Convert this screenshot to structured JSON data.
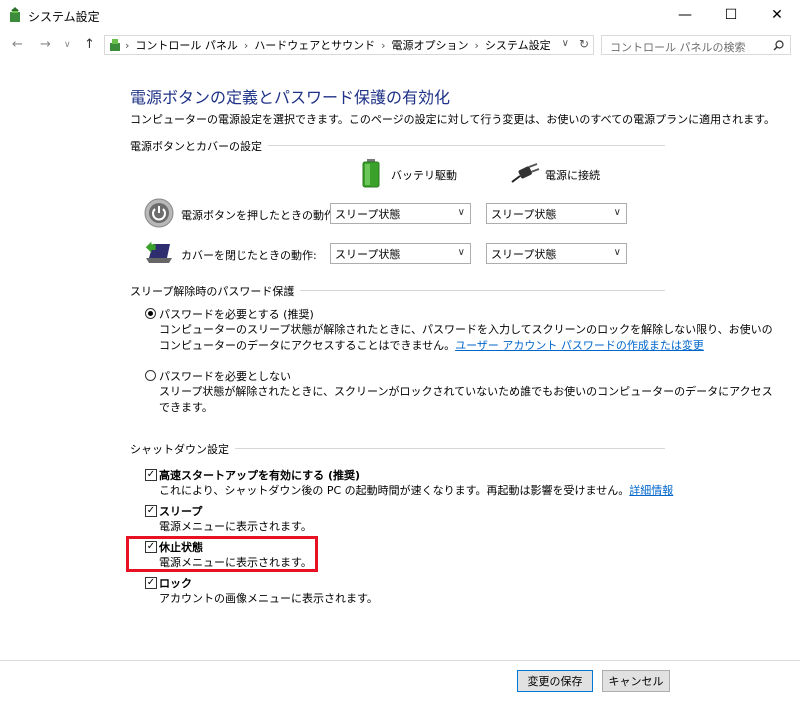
{
  "window": {
    "title": "システム設定",
    "minimize": "—",
    "maximize": "☐",
    "close": "✕"
  },
  "address": {
    "crumbs": [
      "コントロール パネル",
      "ハードウェアとサウンド",
      "電源オプション",
      "システム設定"
    ],
    "search_placeholder": "コントロール パネルの検索"
  },
  "page": {
    "title": "電源ボタンの定義とパスワード保護の有効化",
    "description": "コンピューターの電源設定を選択できます。このページの設定に対して行う変更は、お使いのすべての電源プランに適用されます。"
  },
  "power_buttons": {
    "group_title": "電源ボタンとカバーの設定",
    "col_battery": "バッテリ駆動",
    "col_plugged": "電源に接続",
    "rows": [
      {
        "label": "電源ボタンを押したときの動作:",
        "battery": "スリープ状態",
        "plugged": "スリープ状態"
      },
      {
        "label": "カバーを閉じたときの動作:",
        "battery": "スリープ状態",
        "plugged": "スリープ状態"
      }
    ]
  },
  "password": {
    "group_title": "スリープ解除時のパスワード保護",
    "options": [
      {
        "title": "パスワードを必要とする (推奨)",
        "selected": true,
        "line1": "コンピューターのスリープ状態が解除されたときに、パスワードを入力してスクリーンのロックを解除しない限り、お使いの",
        "line2": "コンピューターのデータにアクセスすることはできません。",
        "link": "ユーザー アカウント パスワードの作成または変更"
      },
      {
        "title": "パスワードを必要としない",
        "selected": false,
        "line1": "スリープ状態が解除されたときに、スクリーンがロックされていないため誰でもお使いのコンピューターのデータにアクセス",
        "line2": "できます。"
      }
    ]
  },
  "shutdown": {
    "group_title": "シャットダウン設定",
    "options": [
      {
        "title": "高速スタートアップを有効にする (推奨)",
        "checked": true,
        "desc": "これにより、シャットダウン後の PC の起動時間が速くなります。再起動は影響を受けません。",
        "link": "詳細情報"
      },
      {
        "title": "スリープ",
        "checked": true,
        "desc": "電源メニューに表示されます。"
      },
      {
        "title": "休止状態",
        "checked": true,
        "desc": "電源メニューに表示されます。"
      },
      {
        "title": "ロック",
        "checked": true,
        "desc": "アカウントの画像メニューに表示されます。"
      }
    ]
  },
  "footer": {
    "save": "変更の保存",
    "cancel": "キャンセル"
  },
  "colors": {
    "title_blue": "#1e3287",
    "link_blue": "#0066cc",
    "highlight_red": "#e81123"
  }
}
